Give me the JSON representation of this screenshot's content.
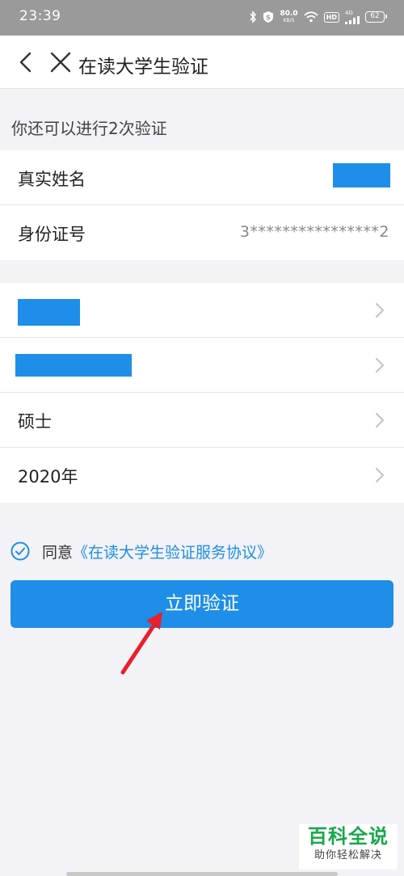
{
  "status_bar": {
    "time": "23:39",
    "speed_value": "80.0",
    "speed_unit": "KB/S",
    "hd_label": "HD",
    "network_label": "4G",
    "battery": "62"
  },
  "nav": {
    "title": "在读大学生验证",
    "back_icon": "chevron-left-icon",
    "close_icon": "close-icon"
  },
  "attempts_text": "你还可以进行2次验证",
  "identity": {
    "name_label": "真实姓名",
    "id_label": "身份证号",
    "id_value": "3****************2"
  },
  "education": {
    "degree": "硕士",
    "year": "2020年"
  },
  "agreement": {
    "prefix": "同意",
    "link_text": "《在读大学生验证服务协议》",
    "checked": true
  },
  "submit_label": "立即验证",
  "watermark": {
    "title": "百科全说",
    "subtitle": "助你轻松解决"
  },
  "colors": {
    "accent": "#1e8ee8",
    "status_bar": "#9a9a9a",
    "background": "#f2f2f7",
    "annotation_arrow": "#e8202a",
    "watermark_green": "#17a84b"
  }
}
